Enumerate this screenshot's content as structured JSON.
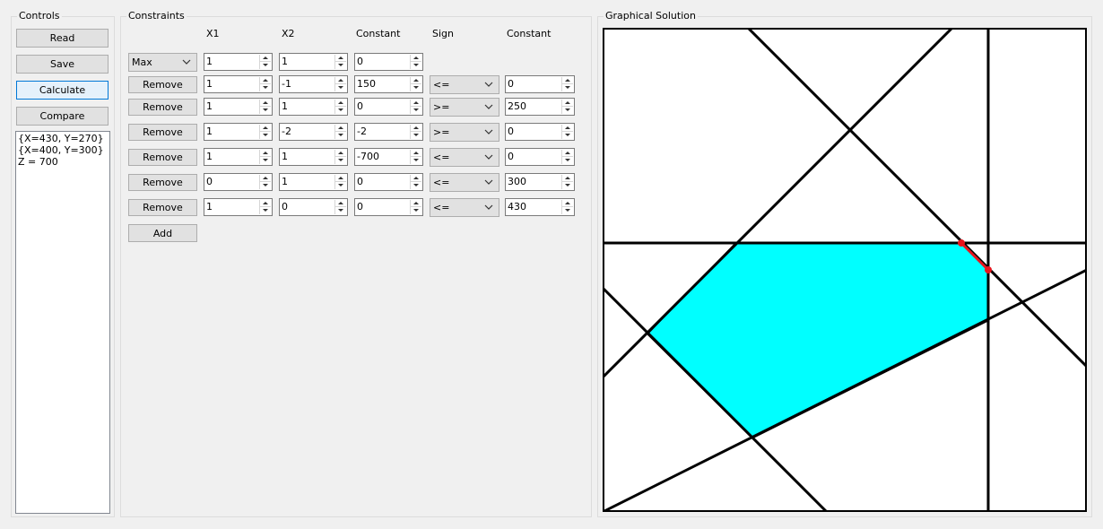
{
  "controls": {
    "title": "Controls",
    "read_label": "Read",
    "save_label": "Save",
    "calculate_label": "Calculate",
    "compare_label": "Compare",
    "output_lines": [
      "{X=430, Y=270}",
      "{X=400, Y=300}",
      "Z = 700"
    ]
  },
  "constraints": {
    "title": "Constraints",
    "headers": {
      "x1": "X1",
      "x2": "X2",
      "constant": "Constant",
      "sign": "Sign",
      "constant2": "Constant"
    },
    "objective": {
      "mode": "Max",
      "x1": "1",
      "x2": "1",
      "constant": "0"
    },
    "rows": [
      {
        "remove_label": "Remove",
        "x1": "1",
        "x2": "-1",
        "constant": "150",
        "sign": "<=",
        "rhs": "0"
      },
      {
        "remove_label": "Remove",
        "x1": "1",
        "x2": "1",
        "constant": "0",
        "sign": ">=",
        "rhs": "250"
      },
      {
        "remove_label": "Remove",
        "x1": "1",
        "x2": "-2",
        "constant": "-2",
        "sign": ">=",
        "rhs": "0"
      },
      {
        "remove_label": "Remove",
        "x1": "1",
        "x2": "1",
        "constant": "-700",
        "sign": "<=",
        "rhs": "0"
      },
      {
        "remove_label": "Remove",
        "x1": "0",
        "x2": "1",
        "constant": "0",
        "sign": "<=",
        "rhs": "300"
      },
      {
        "remove_label": "Remove",
        "x1": "1",
        "x2": "0",
        "constant": "0",
        "sign": "<=",
        "rhs": "430"
      }
    ],
    "add_label": "Add"
  },
  "graph": {
    "title": "Graphical Solution",
    "feasible_color": "#00ffff",
    "optimal_color": "#e8141c",
    "line_color": "#000000"
  }
}
